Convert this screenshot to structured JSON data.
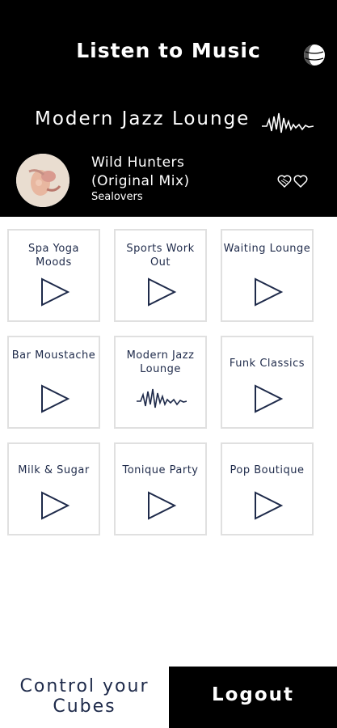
{
  "header": {
    "title": "Listen to Music",
    "settings_icon": "globe-icon"
  },
  "now_playing": {
    "playlist": "Modern Jazz Lounge",
    "track_title": "Wild Hunters (Original Mix)",
    "artist": "Sealovers",
    "like_icon": "heart-icon"
  },
  "playlists": [
    {
      "label": "Spa Yoga Moods",
      "icon": "play-icon"
    },
    {
      "label": "Sports Work Out",
      "icon": "play-icon"
    },
    {
      "label": "Waiting Lounge",
      "icon": "play-icon"
    },
    {
      "label": "Bar Moustache",
      "icon": "play-icon"
    },
    {
      "label": "Modern Jazz Lounge",
      "icon": "waveform-icon"
    },
    {
      "label": "Funk Classics",
      "icon": "play-icon"
    },
    {
      "label": "Milk & Sugar",
      "icon": "play-icon"
    },
    {
      "label": "Tonique Party",
      "icon": "play-icon"
    },
    {
      "label": "Pop Boutique",
      "icon": "play-icon"
    }
  ],
  "footer": {
    "control_label": "Control your Cubes",
    "logout_label": "Logout"
  },
  "colors": {
    "header_bg": "#000000",
    "accent_text": "#1e2a4a",
    "tile_border": "#e0e0e0"
  }
}
